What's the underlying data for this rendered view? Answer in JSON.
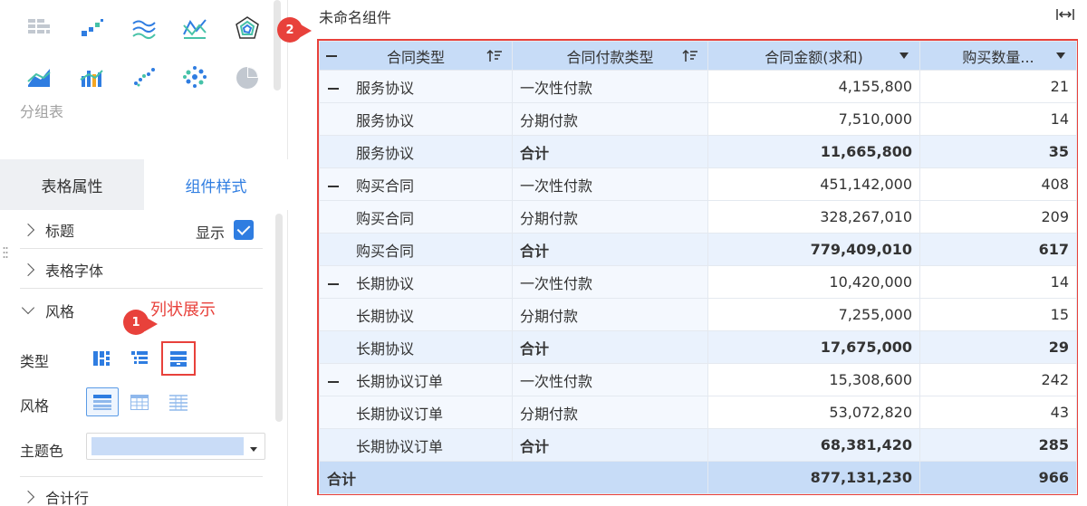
{
  "left_panel": {
    "chart_icons": [
      "crosstab-icon",
      "bar-scatter-icon",
      "multi-line-icon",
      "line-cross-icon",
      "radar-icon",
      "area-line-icon",
      "combo-bar-line-icon",
      "scatter-icon",
      "bubble-icon",
      "pie-icon"
    ],
    "group_label": "分组表",
    "tabs": [
      "表格属性",
      "组件样式"
    ],
    "active_tab": "组件样式",
    "sections": {
      "title": "标题",
      "title_show": "显示",
      "font": "表格字体",
      "style": "风格",
      "type_label": "类型",
      "style_label": "风格",
      "theme_label": "主题色",
      "total_row": "合计行"
    },
    "callout_1": {
      "badge": "1",
      "text": "列状展示"
    },
    "theme_color": "#c9dcf7"
  },
  "component": {
    "title": "未命名组件",
    "callout_2": {
      "badge": "2"
    }
  },
  "table": {
    "headers": [
      "合同类型",
      "合同付款类型",
      "合同金额(求和)",
      "购买数量..."
    ],
    "groups": [
      {
        "name": "服务协议",
        "rows": [
          {
            "type": "一次性付款",
            "amount": "4,155,800",
            "qty": "21"
          },
          {
            "type": "分期付款",
            "amount": "7,510,000",
            "qty": "14"
          }
        ],
        "subtotal_label": "合计",
        "subtotal_amount": "11,665,800",
        "subtotal_qty": "35"
      },
      {
        "name": "购买合同",
        "rows": [
          {
            "type": "一次性付款",
            "amount": "451,142,000",
            "qty": "408"
          },
          {
            "type": "分期付款",
            "amount": "328,267,010",
            "qty": "209"
          }
        ],
        "subtotal_label": "合计",
        "subtotal_amount": "779,409,010",
        "subtotal_qty": "617"
      },
      {
        "name": "长期协议",
        "rows": [
          {
            "type": "一次性付款",
            "amount": "10,420,000",
            "qty": "14"
          },
          {
            "type": "分期付款",
            "amount": "7,255,000",
            "qty": "15"
          }
        ],
        "subtotal_label": "合计",
        "subtotal_amount": "17,675,000",
        "subtotal_qty": "29"
      },
      {
        "name": "长期协议订单",
        "rows": [
          {
            "type": "一次性付款",
            "amount": "15,308,600",
            "qty": "242"
          },
          {
            "type": "分期付款",
            "amount": "53,072,820",
            "qty": "43"
          }
        ],
        "subtotal_label": "合计",
        "subtotal_amount": "68,381,420",
        "subtotal_qty": "285"
      }
    ],
    "grand_total": {
      "label": "合计",
      "amount": "877,131,230",
      "qty": "966"
    }
  },
  "colors": {
    "accent": "#2f7de1",
    "annotation_red": "#e8413b",
    "header_blue": "#c7dcf7"
  }
}
